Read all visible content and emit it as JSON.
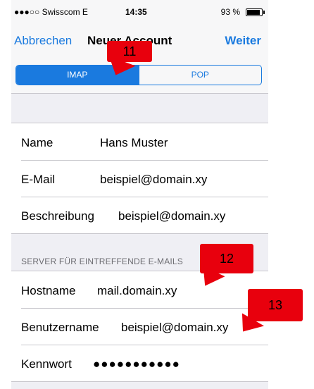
{
  "status": {
    "carrier": "●●●○○ Swisscom  E",
    "time": "14:35",
    "battery": "93 %"
  },
  "nav": {
    "cancel": "Abbrechen",
    "title": "Neuer Account",
    "next": "Weiter"
  },
  "segment": {
    "options": [
      "IMAP",
      "POP"
    ],
    "selected": "IMAP"
  },
  "account": {
    "rows": [
      {
        "label": "Name",
        "value": "Hans Muster"
      },
      {
        "label": "E-Mail",
        "value": "beispiel@domain.xy"
      },
      {
        "label": "Beschreibung",
        "value": "beispiel@domain.xy"
      }
    ]
  },
  "incoming": {
    "header": "SERVER FÜR EINTREFFENDE E-MAILS",
    "rows": [
      {
        "label": "Hostname",
        "value": "mail.domain.xy"
      },
      {
        "label": "Benutzername",
        "value": "beispiel@domain.xy"
      },
      {
        "label": "Kennwort",
        "value": "●●●●●●●●●●●"
      }
    ]
  },
  "callouts": [
    "11",
    "12",
    "13"
  ],
  "colors": {
    "accent": "#1a7adf",
    "callout": "#e8000d"
  }
}
